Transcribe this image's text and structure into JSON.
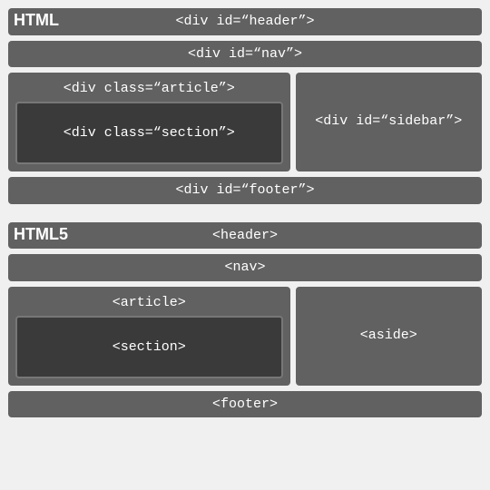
{
  "html4": {
    "title": "HTML",
    "header": "<div id=“header”>",
    "nav": "<div id=“nav”>",
    "article": "<div class=“article”>",
    "section": "<div class=“section”>",
    "sidebar": "<div id=“sidebar”>",
    "footer": "<div id=“footer”>"
  },
  "html5": {
    "title": "HTML5",
    "header": "<header>",
    "nav": "<nav>",
    "article": "<article>",
    "section": "<section>",
    "aside": "<aside>",
    "footer": "<footer>"
  }
}
